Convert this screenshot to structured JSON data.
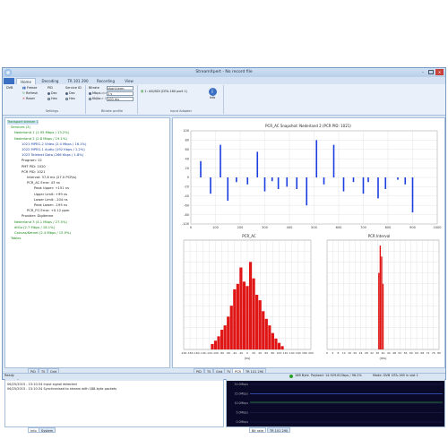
{
  "window": {
    "title": "StreamXpert - No record file"
  },
  "ribbon": {
    "tabs": [
      "Home",
      "Decoding",
      "TR 101 290",
      "Recording",
      "View"
    ],
    "dvb_label": "DVB",
    "buttons": {
      "freeze": "Freeze",
      "refresh": "Refresh",
      "reset": "Reset"
    },
    "pid_label": "PID",
    "pid_options": [
      "Dec",
      "Hex"
    ],
    "service_id_label": "Service ID",
    "service_id_options": [
      "Dec",
      "Hex"
    ],
    "bitrate_label": "Bitrate",
    "bitrate_mode": "short-term",
    "bitrate_options": [
      "Mbps",
      "Kbps"
    ],
    "label_field": "Label",
    "label_value": "1 s",
    "time_slice_label": "Time Slice",
    "time_slice_value": "100 ms",
    "adapter_label": "1: ASI/SDI (DTA-160 port 1)",
    "info_label": "Info",
    "groups": [
      "Settings",
      "Bitrate profile",
      "Input Adapter"
    ]
  },
  "tree": {
    "rows": [
      {
        "text": "Transport stream  1",
        "cls": "green"
      },
      {
        "text": "Services (3)",
        "cls": "green"
      },
      {
        "text": "Nederland 1  (1.95 Mbps / 13.2%)",
        "cls": "green"
      },
      {
        "text": "Nederland 2  (2.8 Mbps / 19.1%)",
        "cls": "green"
      },
      {
        "text": "1021  MPEG-2 Video  (2.4 Mbps / 16.1%)",
        "cls": "blue"
      },
      {
        "text": "1022  MPEG-1 Audio  (192 Kbps / 1.2%)",
        "cls": "blue"
      },
      {
        "text": "1023  Teletext Data  (266 Kbps / 1.8%)",
        "cls": "blue"
      },
      {
        "text": "Program:  12",
        "cls": ""
      },
      {
        "text": "PMT PID:  1020",
        "cls": ""
      },
      {
        "text": "PCR PID:  1021",
        "cls": ""
      },
      {
        "text": "Interval:  37.8 ms (27.0 PCR/s)",
        "cls": ""
      },
      {
        "text": "PCR_AC Error:  43 ns",
        "cls": ""
      },
      {
        "text": "Peak Upper:  +151 ns",
        "cls": ""
      },
      {
        "text": "Upper Limit:  +99 ns",
        "cls": ""
      },
      {
        "text": "Lower Limit:  -104 ns",
        "cls": ""
      },
      {
        "text": "Peak Lower:  -195 ns",
        "cls": ""
      },
      {
        "text": "PCR_FO Error:  +0.12 ppm",
        "cls": ""
      },
      {
        "text": "Provider:  Digitenne",
        "cls": ""
      },
      {
        "text": "Nederland 3  (4.1 Mbps / 27.5%)",
        "cls": "green"
      },
      {
        "text": "dtGo  (2.7 Mbps / 18.1%)",
        "cls": "green"
      },
      {
        "text": "Canvas/Ketnet  (2.4 Mbps / 15.9%)",
        "cls": "green"
      },
      {
        "text": "Tables",
        "cls": "green"
      }
    ]
  },
  "left_tabs": [
    "PID",
    "TS",
    "Grid"
  ],
  "right_tabs": [
    "PID",
    "TS",
    "Grid",
    "TV",
    "PCR",
    "TR 101 290"
  ],
  "messages": {
    "title": "Messages",
    "lines": [
      "06/25/2015 - 15:10:34  Input signal detected",
      "06/25/2015 - 15:10:34  Synchronised to stream with 188-byte packets"
    ],
    "tabs": [
      "Info",
      "System"
    ]
  },
  "trend": {
    "title": "Trend test",
    "ylabels": [
      "20.0Mbps",
      "15.0Mbps",
      "10.0Mbps",
      "5.0Mbps",
      "0.0Mbps"
    ],
    "tabs": [
      "Bit rate",
      "TR 101 290"
    ]
  },
  "status": {
    "ready": "Ready",
    "items": [
      "188 Byte",
      "Payload: 14.929.815bps / 96.2%",
      "Mode: DVB",
      "DTA-160 in slot 1"
    ]
  },
  "charts": {
    "snapshot_title": "PCR_AC Snapshot: Nederland 2 (PCR PID: 1021)",
    "pcr_ac_title": "PCR_AC",
    "pcr_interval_title": "PCR Interval",
    "xunit": "(ns)",
    "xunit_ms": "(ms)"
  },
  "chart_data": [
    {
      "type": "bar",
      "title": "PCR_AC Snapshot: Nederland 2 (PCR PID: 1021)",
      "ylim": [
        -100,
        100
      ],
      "xlim": [
        0,
        1000
      ],
      "yticks": [
        100,
        80,
        60,
        40,
        20,
        0,
        -20,
        -40,
        -60,
        -80,
        -100
      ],
      "xticks": [
        0,
        100,
        200,
        300,
        400,
        500,
        600,
        700,
        800,
        900,
        1000
      ],
      "x": [
        40,
        80,
        120,
        150,
        185,
        230,
        270,
        300,
        330,
        355,
        390,
        430,
        470,
        510,
        540,
        580,
        620,
        660,
        700,
        720,
        760,
        790,
        840,
        870,
        900
      ],
      "values": [
        35,
        -35,
        70,
        -50,
        -10,
        -15,
        55,
        -30,
        -8,
        -25,
        -20,
        -25,
        -60,
        80,
        -15,
        70,
        -30,
        -10,
        -35,
        -10,
        -45,
        -25,
        -5,
        -15,
        -75
      ]
    },
    {
      "type": "bar",
      "title": "PCR_AC",
      "xlim": [
        -200,
        200
      ],
      "xticks": [
        -200,
        -180,
        -160,
        -140,
        -120,
        -100,
        -80,
        -60,
        -40,
        -20,
        0,
        20,
        40,
        60,
        80,
        100,
        120,
        140,
        160,
        180,
        200
      ],
      "x": [
        -110,
        -100,
        -90,
        -80,
        -70,
        -60,
        -50,
        -40,
        -30,
        -20,
        -10,
        0,
        10,
        20,
        30,
        40,
        50,
        60,
        70,
        80,
        90,
        100,
        110
      ],
      "values": [
        5,
        8,
        12,
        18,
        22,
        30,
        40,
        55,
        60,
        75,
        62,
        58,
        80,
        65,
        50,
        45,
        35,
        28,
        22,
        15,
        10,
        6,
        3
      ]
    },
    {
      "type": "bar",
      "title": "PCR Interval",
      "xlim": [
        0,
        80
      ],
      "xticks": [
        0,
        4,
        8,
        12,
        16,
        20,
        24,
        28,
        32,
        36,
        40,
        44,
        48,
        52,
        56,
        60,
        64,
        68,
        72,
        76,
        80
      ],
      "x": [
        37,
        38,
        39,
        40
      ],
      "values": [
        70,
        95,
        85,
        60
      ]
    }
  ]
}
